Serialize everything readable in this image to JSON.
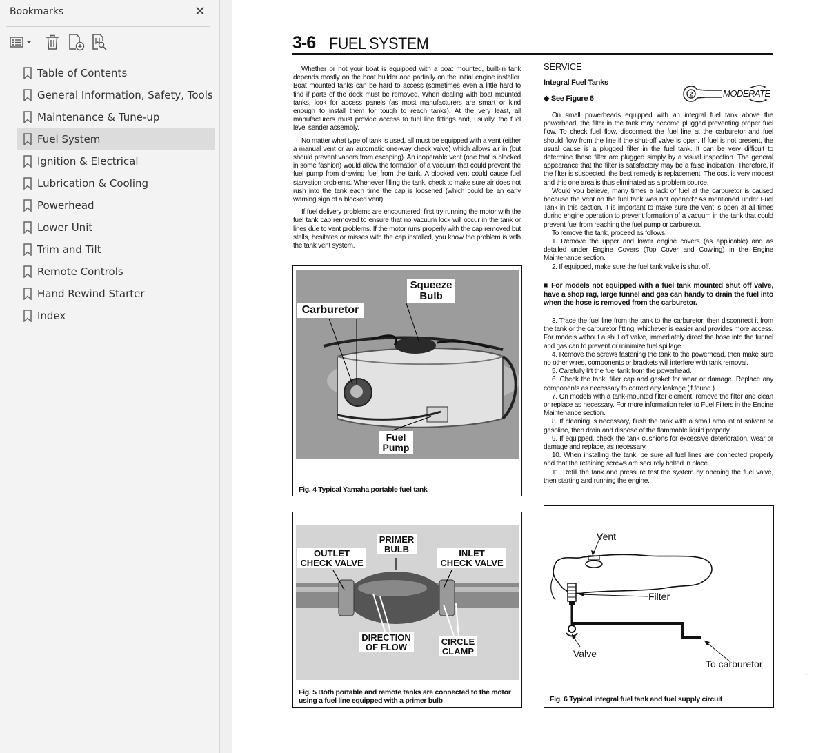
{
  "sidebar": {
    "title": "Bookmarks",
    "close_icon": "close-icon",
    "toolbar": {
      "options_icon": "list-options-icon",
      "delete_icon": "trash-icon",
      "add_icon": "add-bookmark-icon",
      "find_icon": "find-bookmark-icon"
    },
    "items": [
      {
        "label": "Table of Contents"
      },
      {
        "label": "General Information, Safety, Tools"
      },
      {
        "label": "Maintenance & Tune-up"
      },
      {
        "label": "Fuel System"
      },
      {
        "label": "Ignition & Electrical"
      },
      {
        "label": "Lubrication & Cooling"
      },
      {
        "label": "Powerhead"
      },
      {
        "label": "Lower Unit"
      },
      {
        "label": "Trim and Tilt"
      },
      {
        "label": "Remote Controls"
      },
      {
        "label": "Hand Rewind Starter"
      },
      {
        "label": "Index"
      }
    ],
    "selected_index": 3
  },
  "document": {
    "section_number": "3-6",
    "section_title": "FUEL SYSTEM",
    "col1": {
      "p1": "Whether or not your boat is equipped with a boat mounted, built-in tank depends mostly on the boat builder and partially on the initial engine installer. Boat mounted tanks can be hard to access (sometimes even a little hard to find if parts of the deck must be removed. When dealing with boat mounted tanks, look for access panels (as most manufacturers are smart or kind enough to install them for tough to reach tanks). At the very least, all manufacturers must provide access to fuel line fittings and, usually, the fuel level sender assembly.",
      "p2": "No matter what type of tank is used, all must be equipped with a vent (either a manual vent or an automatic one-way check valve) which allows air in (but should prevent vapors from escaping). An inoperable vent (one that is blocked in some fashion) would allow the formation of a vacuum that could prevent the fuel pump from drawing fuel from the tank. A blocked vent could cause fuel starvation problems. Whenever filling the tank, check to make sure air does not rush into the tank each time the cap is loosened (which could be an early warning sign of a blocked vent).",
      "p3": "If fuel delivery problems are encountered, first try running the motor with the fuel tank cap removed to ensure that no vacuum lock will occur in the tank or lines due to vent problems. If the motor runs properly with the cap removed but stalls, hesitates or misses with the cap installed, you know the problem is with the tank vent system."
    },
    "service_heading": "SERVICE",
    "integral_heading": "Integral Fuel Tanks",
    "see_figure": "See Figure 6",
    "difficulty": "MODERATE",
    "col2a": {
      "p1": "On small powerheads equipped with an integral fuel tank above the powerhead, the filter in the tank may become plugged preventing proper fuel flow. To check fuel flow, disconnect the fuel line at the carburetor and fuel should flow from the line if the shut-off valve is open. If fuel is not present, the usual cause is a plugged filter in the fuel tank. It can be very difficult to determine these filter are plugged simply by a visual inspection. The general appearance that the filter is satisfactory may be a false indication. Therefore, if the filter is suspected, the best remedy is replacement. The cost is very modest and this one area is thus eliminated as a problem source.",
      "p2": "Would you believe, many times a lack of fuel at the carburetor is caused because the vent on the fuel tank was not opened? As mentioned under Fuel Tank in this section, it is important to make sure the vent is open at all times during engine operation to prevent formation of a vacuum in the tank that could prevent fuel from reaching the fuel pump or carburetor.",
      "p3": "To remove the tank, proceed as follows:",
      "s1": "1. Remove the upper and lower engine covers (as applicable) and as detailed under Engine Covers (Top Cover and Cowling) in the Engine Maintenance section.",
      "s2": "2. If equipped, make sure the fuel tank valve is shut off."
    },
    "warning": "For models not equipped with a fuel tank mounted shut off valve, have a shop rag, large funnel and gas can handy to drain the fuel into when the hose is removed from the carburetor.",
    "col2c": {
      "s3": "3. Trace the fuel line from the tank to the carburetor, then disconnect it from the tank or the carburetor fitting, whichever is easier and provides more access. For models without a shut off valve, immediately direct the hose into the funnel and gas can to prevent or minimize fuel spillage.",
      "s4": "4. Remove the screws fastening the tank to the powerhead, then make sure no other wires, components or brackets will interfere with tank removal.",
      "s5": "5. Carefully lift the fuel tank from the powerhead.",
      "s6": "6. Check the tank, filler cap and gasket for wear or damage. Replace any components as necessary to correct any leakage (if found.)",
      "s7": "7. On models with a tank-mounted filter element, remove the filter and clean or replace as necessary. For more information refer to Fuel Filters in the Engine Maintenance section.",
      "s8": "8. If cleaning is necessary, flush the tank with a small amount of solvent or gasoline, then drain and dispose of the flammable liquid properly.",
      "s9": "9. If equipped, check the tank cushions for excessive deterioration, wear or damage and replace, as necessary.",
      "s10": "10. When installing the tank, be sure all fuel lines are connected properly and that the retaining screws are securely bolted in place.",
      "s11": "11. Refill the tank and pressure test the system by opening the fuel valve, then starting and running the engine."
    },
    "fig4": {
      "caption": "Fig. 4 Typical Yamaha portable fuel tank",
      "label_squeeze": "Squeeze",
      "label_bulb": "Bulb",
      "label_carburetor": "Carburetor",
      "label_fuel": "Fuel",
      "label_pump": "Pump"
    },
    "fig5": {
      "caption": "Fig. 5 Both portable and remote tanks are connected to the motor using a fuel line equipped with a primer bulb",
      "primer_1": "PRIMER",
      "primer_2": "BULB",
      "outlet_1": "OUTLET",
      "outlet_2": "CHECK VALVE",
      "inlet_1": "INLET",
      "inlet_2": "CHECK VALVE",
      "direction_1": "DIRECTION",
      "direction_2": "OF FLOW",
      "clamp_1": "CIRCLE",
      "clamp_2": "CLAMP"
    },
    "fig6": {
      "caption": "Fig. 6 Typical integral fuel tank and fuel supply circuit",
      "vent": "Vent",
      "filter": "Filter",
      "valve": "Valve",
      "to_carb": "To carburetor"
    },
    "page_mark": "--"
  }
}
